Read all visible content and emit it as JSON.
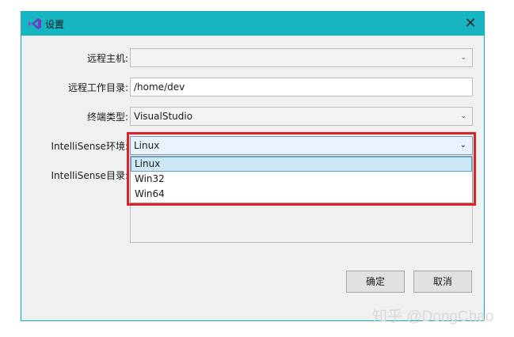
{
  "window": {
    "title": "设置",
    "close_glyph": "✕"
  },
  "form": {
    "remote_host": {
      "label": "远程主机:",
      "value": ""
    },
    "remote_workdir": {
      "label": "远程工作目录:",
      "value": "/home/dev"
    },
    "terminal_type": {
      "label": "终端类型:",
      "value": "VisualStudio"
    },
    "intellisense_env": {
      "label": "IntelliSense环境:",
      "value": "Linux",
      "options": [
        "Linux",
        "Win32",
        "Win64"
      ],
      "selected_index": 0
    },
    "intellisense_dir": {
      "label": "IntelliSense目录:"
    }
  },
  "buttons": {
    "ok": "确定",
    "cancel": "取消"
  },
  "watermark": "知乎 @DongChao",
  "colors": {
    "titlebar": "#17b4c1",
    "highlight_border": "#dc2228",
    "icon": "#7b4fc8"
  },
  "icons": {
    "app": "visual-studio-icon",
    "chevron": "chevron-down-icon",
    "close": "close-icon"
  }
}
